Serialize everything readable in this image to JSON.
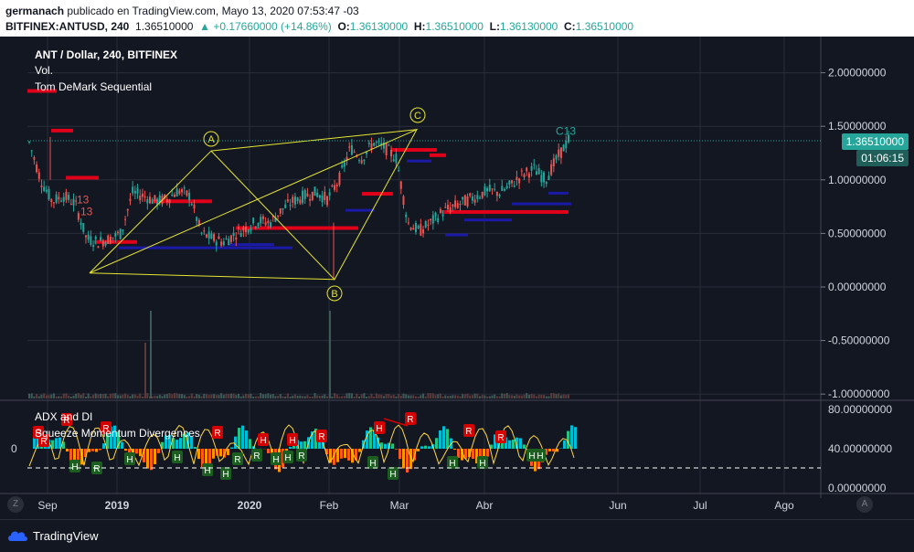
{
  "header": {
    "author": "germanach",
    "published_text": " publicado en TradingView.com, Mayo 13, 2020 07:53:47 -03",
    "symbol": "BITFINEX:ANTUSD, 240",
    "last": "1.36510000",
    "change": "▲ +0.17660000 (+14.86%)",
    "o_label": "O:",
    "o": "1.36130000",
    "h_label": "H:",
    "h": "1.36510000",
    "l_label": "L:",
    "l": "1.36130000",
    "c_label": "C:",
    "c": "1.36510000"
  },
  "legend": {
    "title": "ANT / Dollar, 240, BITFINEX",
    "vol": "Vol.",
    "td": "Tom DeMark Sequential",
    "adx": "ADX and DI",
    "sqz": "Squeeze Momentum Divergences"
  },
  "price_tag": "1.36510000",
  "countdown": "01:06:15",
  "pattern_labels": [
    "A",
    "B",
    "C"
  ],
  "td_labels": [
    "C13",
    "13",
    "13"
  ],
  "signal_labels": {
    "red": "R",
    "green": "H",
    "red2": "H",
    "green2": "R"
  },
  "footer": {
    "brand": "TradingView",
    "z_btn": "Z",
    "a_btn": "A"
  },
  "colors": {
    "bg": "#131722",
    "up": "#26a69a",
    "down": "#ef5350",
    "grid": "#2a2e39",
    "red_level": "#e0001a",
    "blue_level": "#1a1aa6",
    "pattern": "#e6e632"
  },
  "chart_data": {
    "type": "line",
    "price_axis": {
      "ticks": [
        "2.00000000",
        "1.50000000",
        "1.00000000",
        "0.50000000",
        "0.00000000",
        "-0.50000000",
        "-1.00000000"
      ],
      "ylim": [
        -1.0,
        2.1
      ]
    },
    "sub_axis": {
      "ticks": [
        "80.00000000",
        "40.00000000",
        "0.00000000"
      ],
      "left_tick": "0"
    },
    "x_ticks": [
      "Sep",
      "2019",
      "2020",
      "Feb",
      "Mar",
      "Abr",
      "Jun",
      "Jul",
      "Ago"
    ],
    "pattern_points": [
      {
        "label": "",
        "x": "start",
        "y": 0.13
      },
      {
        "label": "A",
        "x": "A",
        "y": 1.27
      },
      {
        "label": "B",
        "x": "B",
        "y": 0.07
      },
      {
        "label": "C",
        "x": "C",
        "y": 1.47
      }
    ],
    "series": [
      {
        "values": [
          1.35,
          1.0,
          0.8,
          0.85,
          0.78,
          0.45,
          0.42,
          0.45,
          0.5,
          0.88,
          0.85,
          0.8,
          0.82,
          0.9,
          0.85,
          0.5,
          0.45,
          0.42,
          0.5,
          0.56,
          0.62,
          0.6,
          0.72,
          0.8,
          0.85,
          0.88,
          0.82,
          1.0,
          1.3,
          1.2,
          1.35,
          1.3,
          1.2,
          0.6,
          0.52,
          0.6,
          0.7,
          0.75,
          0.8,
          0.85,
          0.9,
          0.88,
          0.95,
          1.05,
          1.1,
          1.0,
          1.2,
          1.37
        ]
      }
    ]
  }
}
